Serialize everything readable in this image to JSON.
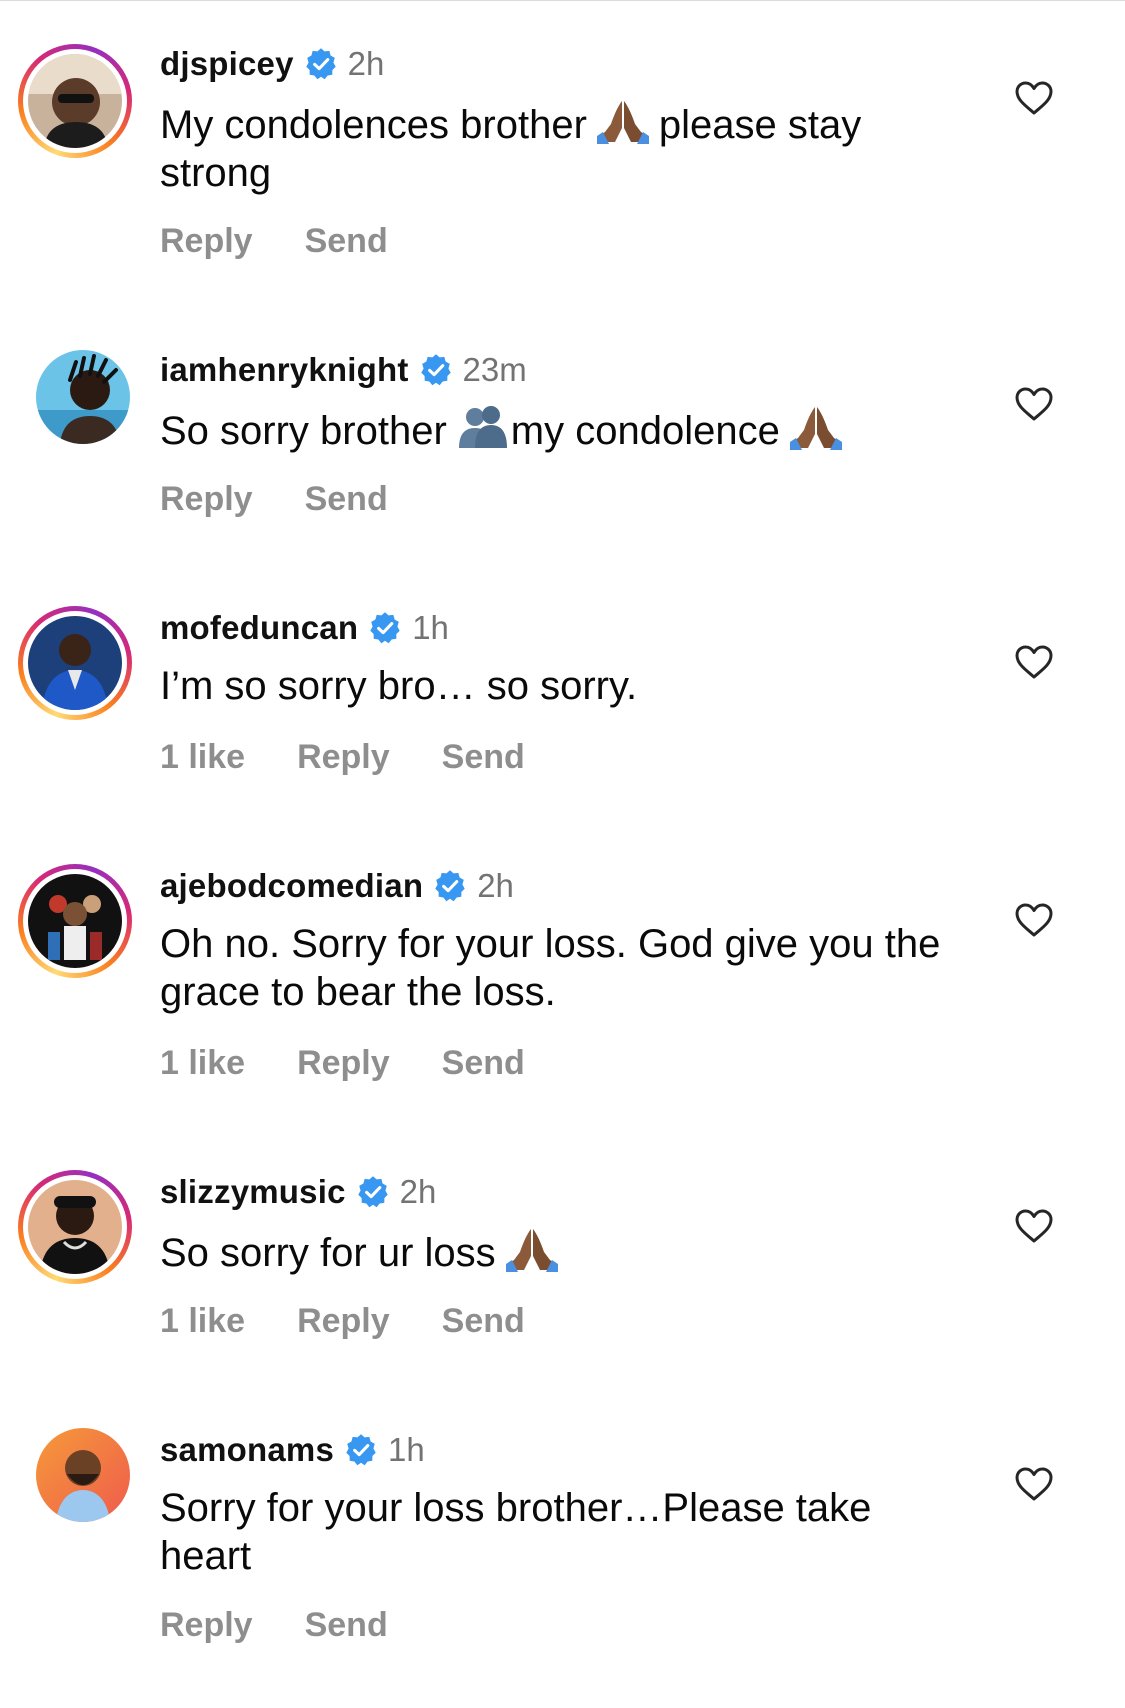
{
  "colors": {
    "verified_badge": "#3897f0",
    "username": "#111111",
    "muted": "#737373",
    "action": "#8e8e8e"
  },
  "icons": {
    "verified": "verified-badge-icon",
    "like": "heart-outline-icon",
    "pray": "folded-hands-emoji",
    "hug": "people-hugging-emoji"
  },
  "comments": [
    {
      "username": "djspicey",
      "time": "2h",
      "text_a": "My condolences brother",
      "text_b": "please stay strong",
      "likes": "",
      "reply_label": "Reply",
      "send_label": "Send"
    },
    {
      "username": "iamhenryknight",
      "time": "23m",
      "text_a": "So sorry brother",
      "text_b": "my condolence",
      "likes": "",
      "reply_label": "Reply",
      "send_label": "Send"
    },
    {
      "username": "mofeduncan",
      "time": "1h",
      "text_a": "I’m so sorry bro… so sorry.",
      "likes": "1 like",
      "reply_label": "Reply",
      "send_label": "Send"
    },
    {
      "username": "ajebodcomedian",
      "time": "2h",
      "text_a": "Oh no.  Sorry for your loss. God give you the grace to bear the loss.",
      "likes": "1 like",
      "reply_label": "Reply",
      "send_label": "Send"
    },
    {
      "username": "slizzymusic",
      "time": "2h",
      "text_a": "So sorry for ur loss",
      "likes": "1 like",
      "reply_label": "Reply",
      "send_label": "Send"
    },
    {
      "username": "samonams",
      "time": "1h",
      "text_a": "Sorry for your loss brother…Please take heart",
      "likes": "",
      "reply_label": "Reply",
      "send_label": "Send"
    }
  ]
}
